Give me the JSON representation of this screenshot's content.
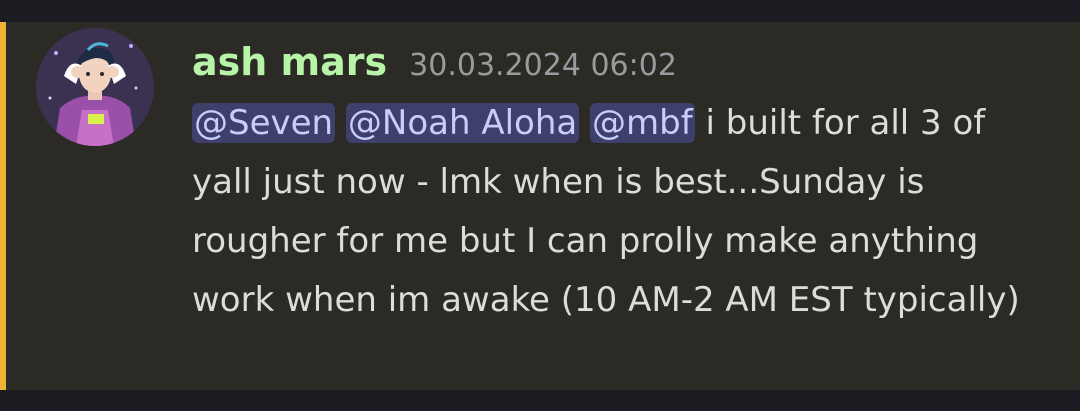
{
  "message": {
    "author": "ash mars",
    "timestamp": "30.03.2024 06:02",
    "mentions": [
      "@Seven",
      "@Noah Aloha",
      "@mbf"
    ],
    "text": "i built for all 3 of yall just now - lmk when is best...Sunday is rougher for me but I can prolly make anything work when im awake (10 AM-2 AM EST typically)"
  },
  "colors": {
    "accent": "#f0b232",
    "username": "#b7f4a8",
    "mention_bg": "#3e3f6a",
    "mention_text": "#c9cdfb",
    "message_bg": "#2b2a24"
  },
  "icons": {
    "avatar": "user-avatar-image"
  }
}
